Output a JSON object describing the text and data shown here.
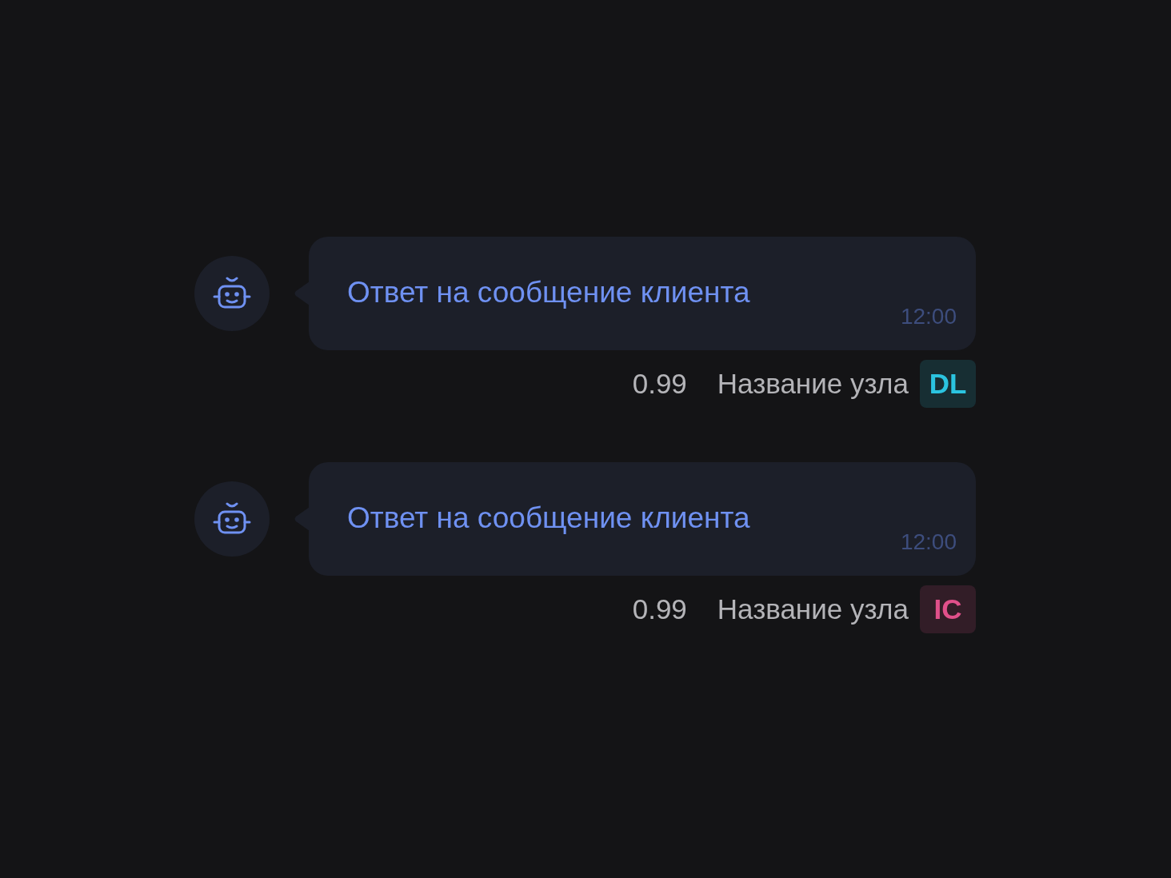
{
  "messages": [
    {
      "text": "Ответ на сообщение клиента",
      "time": "12:00",
      "score": "0.99",
      "node": "Название узла",
      "badge": {
        "label": "DL",
        "color": "#2bc4e0"
      }
    },
    {
      "text": "Ответ на сообщение клиента",
      "time": "12:00",
      "score": "0.99",
      "node": "Название узла",
      "badge": {
        "label": "IC",
        "color": "#e0508a"
      }
    }
  ]
}
